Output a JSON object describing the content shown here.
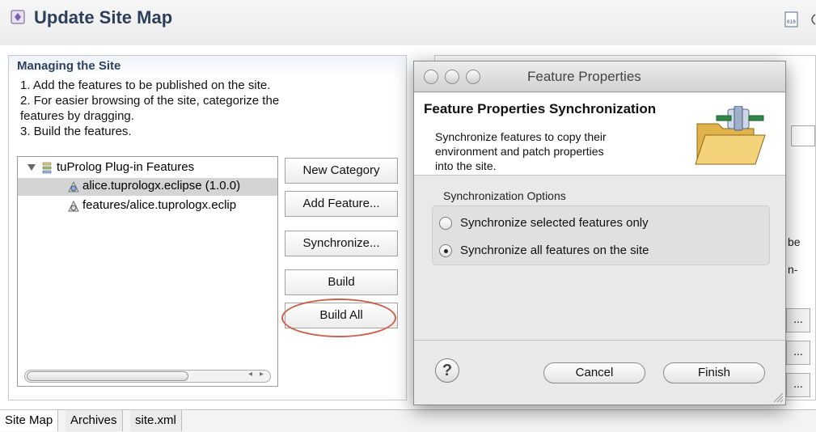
{
  "header": {
    "title": "Update Site Map"
  },
  "managing": {
    "title": "Managing the Site",
    "instructions": [
      "1. Add the features to be published on the site.",
      "2. For easier browsing of the site, categorize the",
      "features by dragging.",
      "3. Build the features."
    ],
    "tree": [
      {
        "label": "tuProlog Plug-in Features",
        "icon": "category-icon",
        "expanded": true
      },
      {
        "label": "alice.tuprologx.eclipse (1.0.0)",
        "icon": "feature-icon",
        "selected": true
      },
      {
        "label": "features/alice.tuprologx.eclip",
        "icon": "feature-icon"
      }
    ],
    "buttons": {
      "new_category": "New Category",
      "add_feature": "Add Feature...",
      "synchronize": "Synchronize...",
      "build": "Build",
      "build_all": "Build All"
    }
  },
  "background_right": {
    "fragment_1": "be",
    "fragment_2": "n-",
    "btn_ellipsis": "..."
  },
  "tabs": [
    "Site Map",
    "Archives",
    "site.xml"
  ],
  "dialog": {
    "window_title": "Feature Properties",
    "heading": "Feature Properties Synchronization",
    "description": [
      "Synchronize features to copy their",
      "environment and patch properties",
      "into the site."
    ],
    "options_label": "Synchronization Options",
    "options": [
      {
        "label": "Synchronize selected features only",
        "selected": false
      },
      {
        "label": "Synchronize all features on the site",
        "selected": true
      }
    ],
    "help": "?",
    "cancel": "Cancel",
    "finish": "Finish"
  },
  "colors": {
    "title_blue": "#2c3f5a",
    "highlight_ring": "#c9604c",
    "selection": "#d4d4d4"
  }
}
